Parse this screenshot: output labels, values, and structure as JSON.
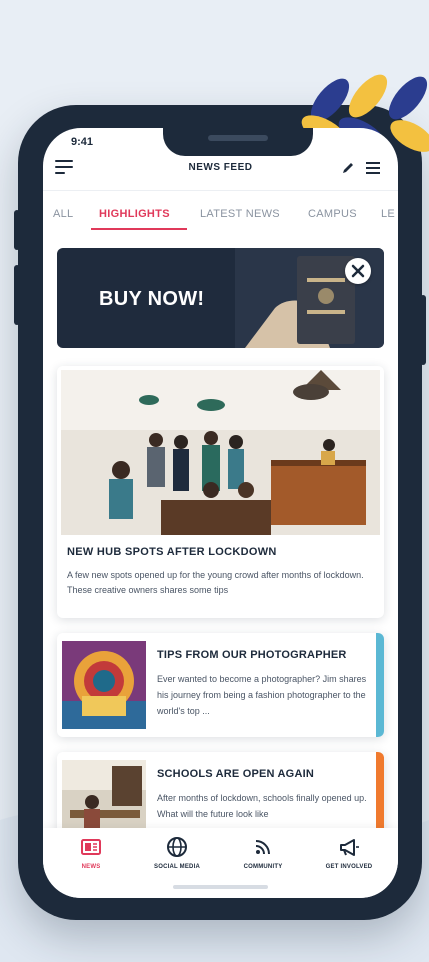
{
  "status": {
    "time": "9:41"
  },
  "header": {
    "title": "NEWS FEED"
  },
  "tabs": [
    {
      "label": "ALL"
    },
    {
      "label": "HIGHLIGHTS"
    },
    {
      "label": "LATEST NEWS"
    },
    {
      "label": "CAMPUS"
    },
    {
      "label": "LE"
    }
  ],
  "banner": {
    "label": "BUY NOW!"
  },
  "feature": {
    "title": "NEW HUB SPOTS AFTER LOCKDOWN",
    "text": "A few new spots opened up for the young crowd after months of lockdown. These creative owners shares some tips"
  },
  "articles": [
    {
      "title": "TIPS FROM OUR PHOTOGRAPHER",
      "text": "Ever wanted to become a photographer? Jim shares his journey from being a fashion photographer to the world's top ...",
      "accent": "#5bb8d4"
    },
    {
      "title": "SCHOOLS ARE OPEN AGAIN",
      "text": "After months of lockdown, schools finally opened up. What will the future look like",
      "accent": "#f07a2e"
    }
  ],
  "nav": [
    {
      "label": "NEWS",
      "icon": "news-icon"
    },
    {
      "label": "SOCIAL MEDIA",
      "icon": "globe-icon"
    },
    {
      "label": "COMMUNITY",
      "icon": "rss-icon"
    },
    {
      "label": "GET INVOLVED",
      "icon": "megaphone-icon"
    }
  ],
  "colors": {
    "accent": "#e0395a",
    "navy": "#1d2a3b",
    "leaf_gold": "#f3c140"
  }
}
